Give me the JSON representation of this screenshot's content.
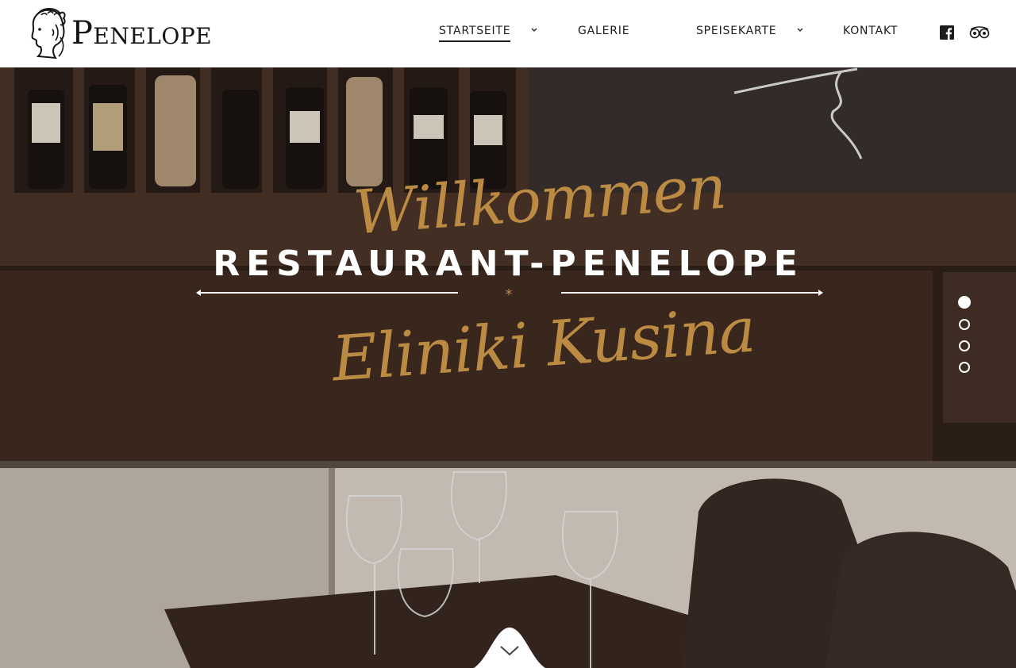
{
  "brand": {
    "name": "Penelope",
    "logo_icon": "greek-head-logo-icon"
  },
  "nav": {
    "items": [
      {
        "label": "STARTSEITE",
        "active": true,
        "has_dropdown": true
      },
      {
        "label": "GALERIE",
        "active": false,
        "has_dropdown": false
      },
      {
        "label": "SPEISEKARTE",
        "active": false,
        "has_dropdown": true
      },
      {
        "label": "KONTAKT",
        "active": false,
        "has_dropdown": false
      }
    ],
    "social": [
      {
        "icon": "facebook-icon"
      },
      {
        "icon": "tripadvisor-icon"
      }
    ]
  },
  "hero": {
    "script_top": "Willkommen",
    "title": "RESTAURANT-PENELOPE",
    "divider_ornament": "*",
    "script_bottom": "Eliniki Kusina",
    "slider": {
      "count": 4,
      "active_index": 0
    },
    "scroll_icon": "chevron-down-icon"
  },
  "colors": {
    "accent_gold": "#bb8a43",
    "text_dark": "#1c1c1c",
    "white": "#ffffff"
  }
}
